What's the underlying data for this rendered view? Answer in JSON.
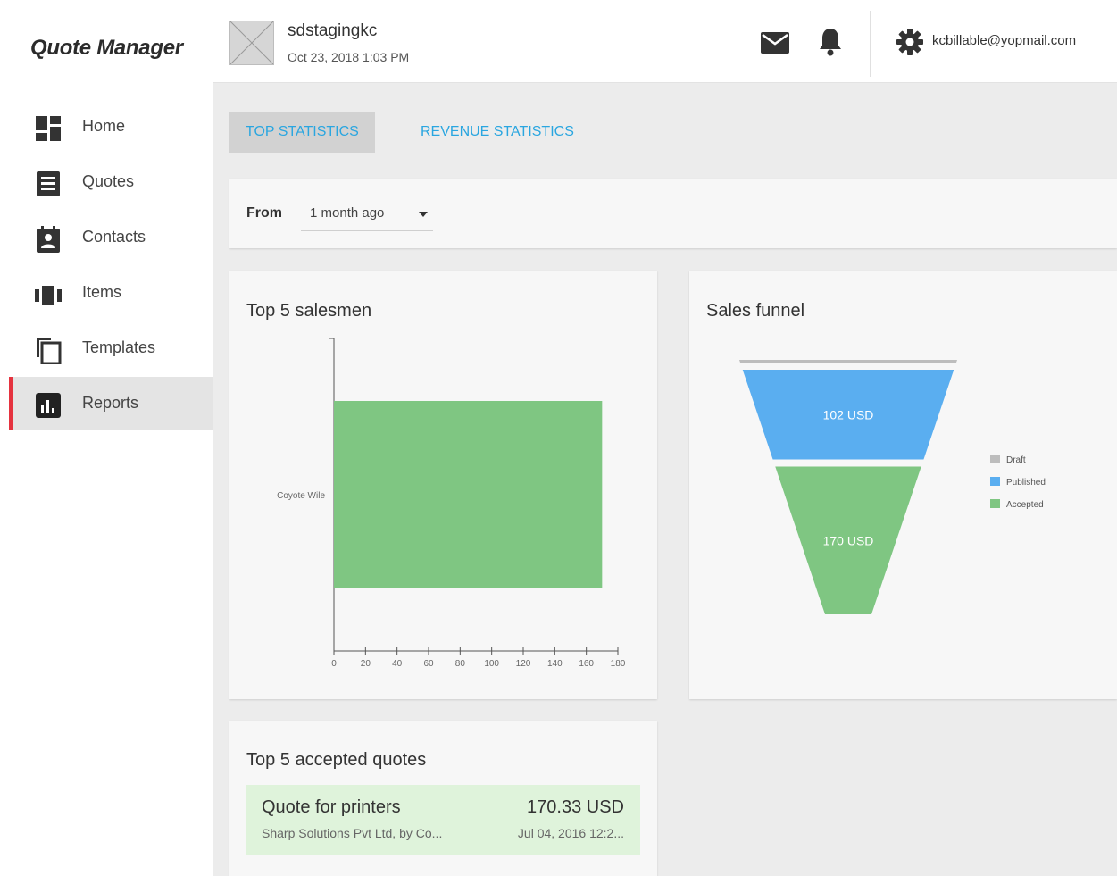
{
  "app": {
    "title": "Quote Manager"
  },
  "account": {
    "name": "sdstagingkc",
    "datetime": "Oct 23, 2018 1:03 PM"
  },
  "user": {
    "email": "kcbillable@yopmail.com"
  },
  "icons": {
    "mail": "mail-icon",
    "notifications": "bell-icon",
    "settings": "gear-icon"
  },
  "nav": {
    "items": [
      {
        "label": "Home",
        "icon": "dashboard-icon"
      },
      {
        "label": "Quotes",
        "icon": "document-icon"
      },
      {
        "label": "Contacts",
        "icon": "contact-card-icon"
      },
      {
        "label": "Items",
        "icon": "items-icon"
      },
      {
        "label": "Templates",
        "icon": "copy-icon"
      },
      {
        "label": "Reports",
        "icon": "bar-chart-icon",
        "active": true
      }
    ]
  },
  "tabs": [
    {
      "label": "TOP STATISTICS",
      "active": true
    },
    {
      "label": "REVENUE STATISTICS",
      "active": false
    }
  ],
  "filter": {
    "label": "From",
    "value": "1 month ago"
  },
  "colors": {
    "accent_blue": "#2aa6e0",
    "active_marker": "#e5333f",
    "green": "#7fc682",
    "blue": "#5aaef0",
    "gray": "#bdbdbd"
  },
  "salesmen_card": {
    "title": "Top 5 salesmen"
  },
  "funnel_card": {
    "title": "Sales funnel"
  },
  "quotes_card": {
    "title": "Top 5 accepted quotes",
    "items": [
      {
        "title": "Quote for printers",
        "amount": "170.33 USD",
        "subtitle": "Sharp Solutions Pvt Ltd, by Co...",
        "date": "Jul 04, 2016 12:2..."
      }
    ]
  },
  "chart_data": [
    {
      "type": "bar",
      "orientation": "horizontal",
      "title": "Top 5 salesmen",
      "categories": [
        "Coyote Wile"
      ],
      "values": [
        170
      ],
      "xlim": [
        0,
        180
      ],
      "xticks": [
        0,
        20,
        40,
        60,
        80,
        100,
        120,
        140,
        160,
        180
      ],
      "grid": false,
      "color": "#7fc682"
    },
    {
      "type": "funnel",
      "title": "Sales funnel",
      "legend_position": "right",
      "series": [
        {
          "name": "Draft",
          "value": 0,
          "label": "",
          "color": "#bdbdbd"
        },
        {
          "name": "Published",
          "value": 102,
          "label": "102 USD",
          "color": "#5aaef0"
        },
        {
          "name": "Accepted",
          "value": 170,
          "label": "170 USD",
          "color": "#7fc682"
        }
      ]
    }
  ]
}
